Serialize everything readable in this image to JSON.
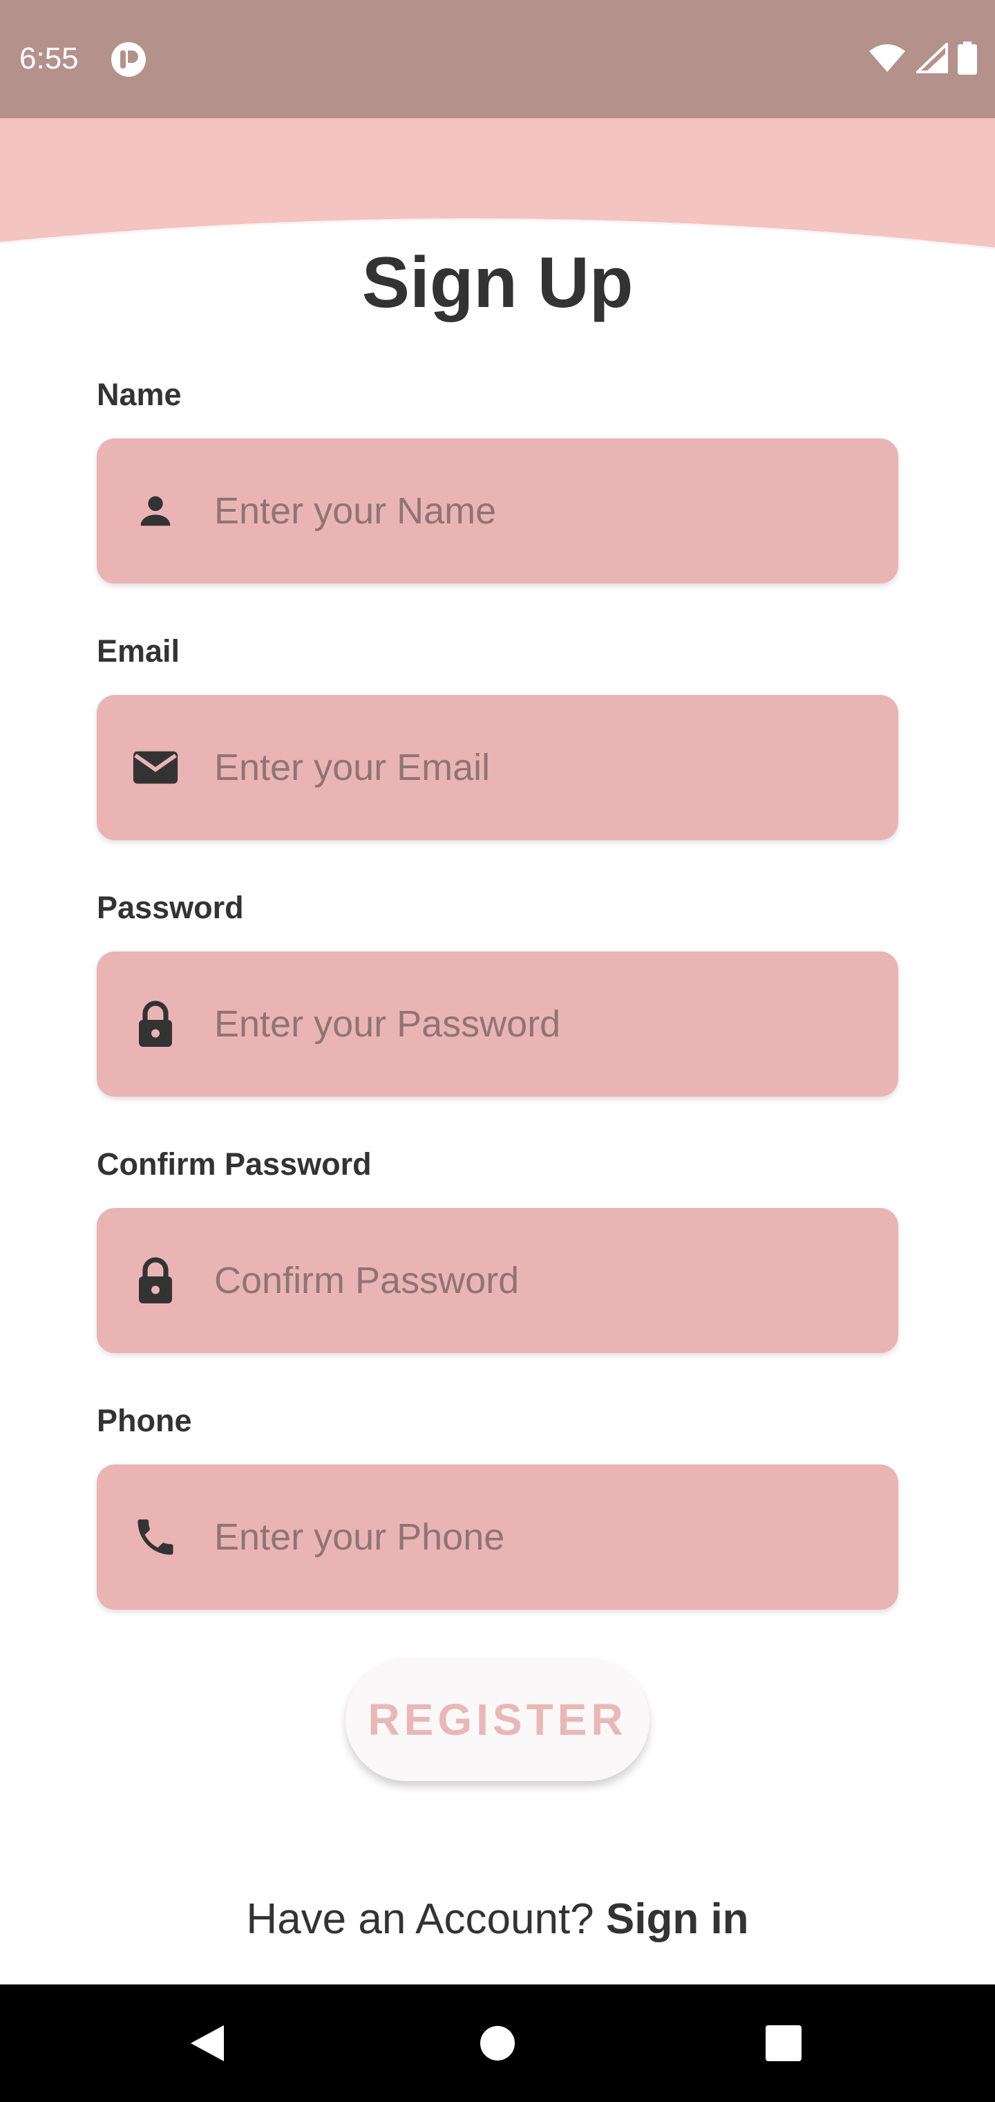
{
  "status_bar": {
    "time": "6:55",
    "app_icon": "app-notification-icon",
    "icons": [
      "wifi-icon",
      "signal-icon",
      "battery-icon"
    ],
    "background": "#b5918c"
  },
  "page": {
    "title": "Sign Up",
    "header_color": "#f4c4c0",
    "field_color": "#ebb4b4"
  },
  "form": {
    "fields": [
      {
        "label": "Name",
        "placeholder": "Enter your Name",
        "value": "",
        "icon": "person-icon"
      },
      {
        "label": "Email",
        "placeholder": "Enter your Email",
        "value": "",
        "icon": "mail-icon"
      },
      {
        "label": "Password",
        "placeholder": "Enter your Password",
        "value": "",
        "icon": "lock-icon"
      },
      {
        "label": "Confirm Password",
        "placeholder": "Confirm Password",
        "value": "",
        "icon": "lock-icon"
      },
      {
        "label": "Phone",
        "placeholder": "Enter your Phone",
        "value": "",
        "icon": "phone-icon"
      }
    ],
    "register_label": "REGISTER"
  },
  "footer": {
    "prompt": "Have an Account?",
    "link": "Sign in"
  },
  "nav_bar": {
    "buttons": [
      "back-icon",
      "home-icon",
      "recents-icon"
    ]
  }
}
